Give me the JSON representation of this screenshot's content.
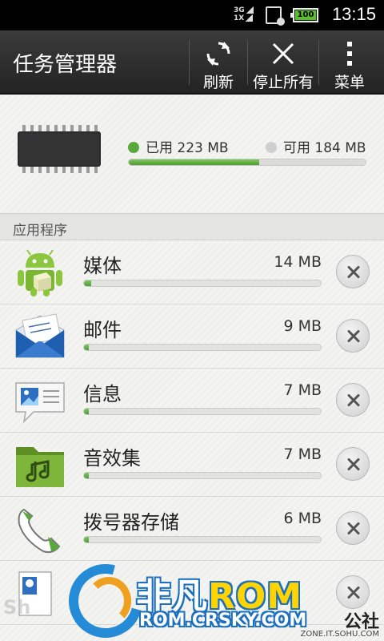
{
  "status_bar": {
    "network": "3G",
    "network2": "1X",
    "battery": "100",
    "time": "13:15"
  },
  "action_bar": {
    "title": "任务管理器",
    "refresh_label": "刷新",
    "stop_all_label": "停止所有",
    "menu_label": "菜单"
  },
  "memory": {
    "used_label": "已用 223 MB",
    "free_label": "可用 184 MB",
    "used_fraction": 0.55,
    "used_color": "#5aa83a",
    "free_color": "#cfcfcf"
  },
  "section_header": "应用程序",
  "apps": [
    {
      "name": "媒体",
      "size": "14 MB",
      "fraction": 0.03,
      "icon": "android-robot-icon"
    },
    {
      "name": "邮件",
      "size": "9 MB",
      "fraction": 0.02,
      "icon": "mail-envelope-icon"
    },
    {
      "name": "信息",
      "size": "7 MB",
      "fraction": 0.015,
      "icon": "messages-icon"
    },
    {
      "name": "音效集",
      "size": "7 MB",
      "fraction": 0.015,
      "icon": "music-folder-icon"
    },
    {
      "name": "拨号器存储",
      "size": "6 MB",
      "fraction": 0.012,
      "icon": "phone-handset-icon"
    }
  ],
  "watermark": {
    "brand_a": "非凡",
    "brand_b": "ROM",
    "url": "ROM.CRSKY.COM",
    "left_text": "Sh",
    "sohu": "公社",
    "sohu_url": "ZONE.IT.SOHU.COM"
  }
}
